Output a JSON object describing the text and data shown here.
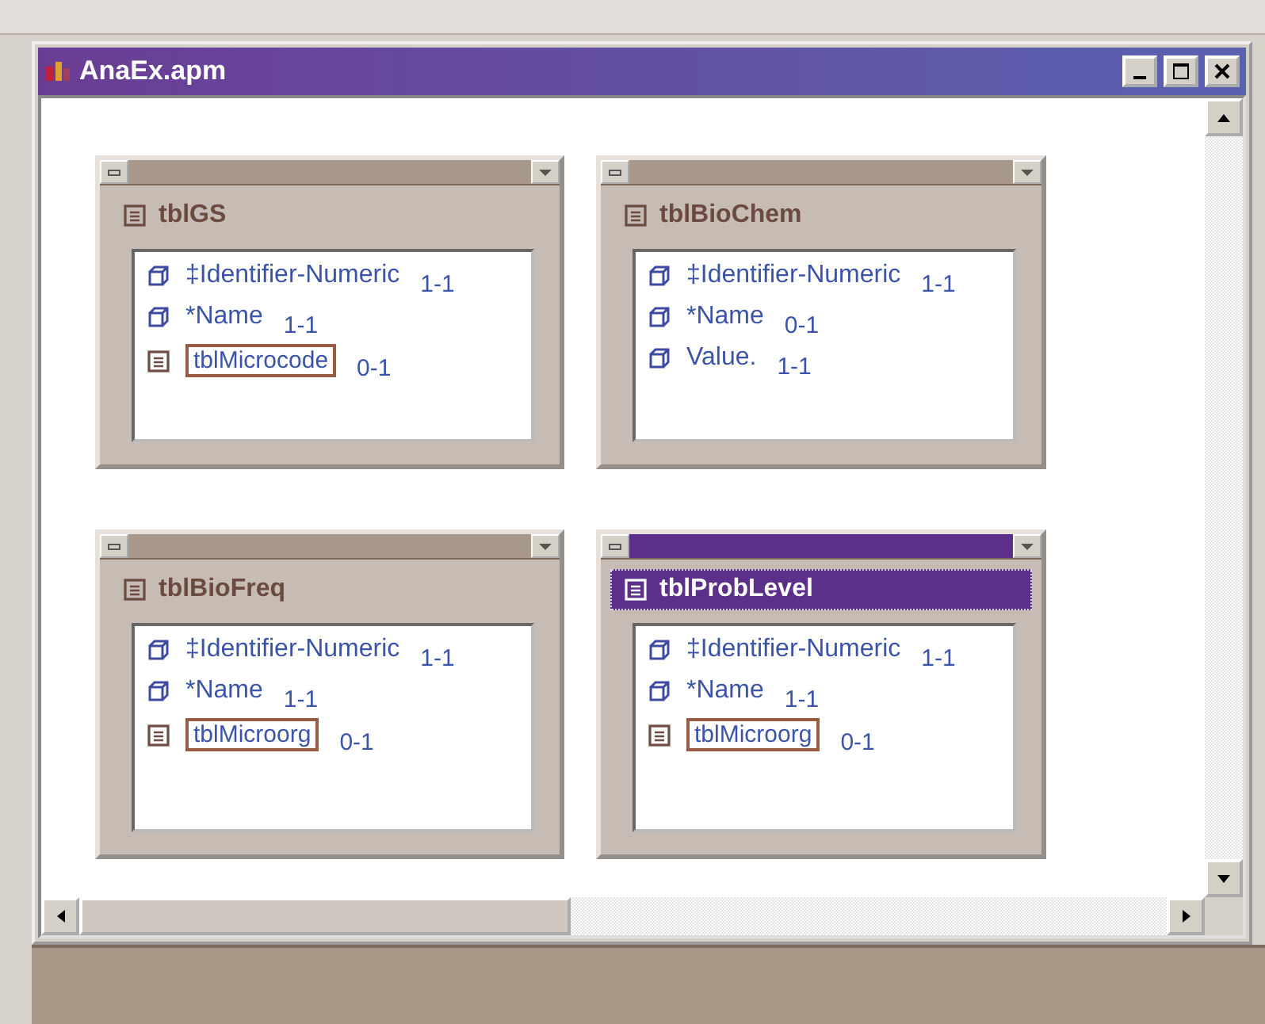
{
  "window": {
    "title": "AnaEx.apm"
  },
  "tables": [
    {
      "name": "tblGS",
      "selected": false,
      "fields": [
        {
          "kind": "attribute",
          "name": "‡Identifier-Numeric",
          "cardinality": "1-1"
        },
        {
          "kind": "attribute",
          "name": "*Name",
          "cardinality": "1-1"
        },
        {
          "kind": "reference",
          "name": "tblMicrocode",
          "cardinality": "0-1"
        }
      ]
    },
    {
      "name": "tblBioChem",
      "selected": false,
      "fields": [
        {
          "kind": "attribute",
          "name": "‡Identifier-Numeric",
          "cardinality": "1-1"
        },
        {
          "kind": "attribute",
          "name": "*Name",
          "cardinality": "0-1"
        },
        {
          "kind": "attribute",
          "name": "Value.",
          "cardinality": "1-1"
        }
      ]
    },
    {
      "name": "tblBioFreq",
      "selected": false,
      "fields": [
        {
          "kind": "attribute",
          "name": "‡Identifier-Numeric",
          "cardinality": "1-1"
        },
        {
          "kind": "attribute",
          "name": "*Name",
          "cardinality": "1-1"
        },
        {
          "kind": "reference",
          "name": "tblMicroorg",
          "cardinality": "0-1"
        }
      ]
    },
    {
      "name": "tblProbLevel",
      "selected": true,
      "fields": [
        {
          "kind": "attribute",
          "name": "‡Identifier-Numeric",
          "cardinality": "1-1"
        },
        {
          "kind": "attribute",
          "name": "*Name",
          "cardinality": "1-1"
        },
        {
          "kind": "reference",
          "name": "tblMicroorg",
          "cardinality": "0-1"
        }
      ]
    }
  ]
}
